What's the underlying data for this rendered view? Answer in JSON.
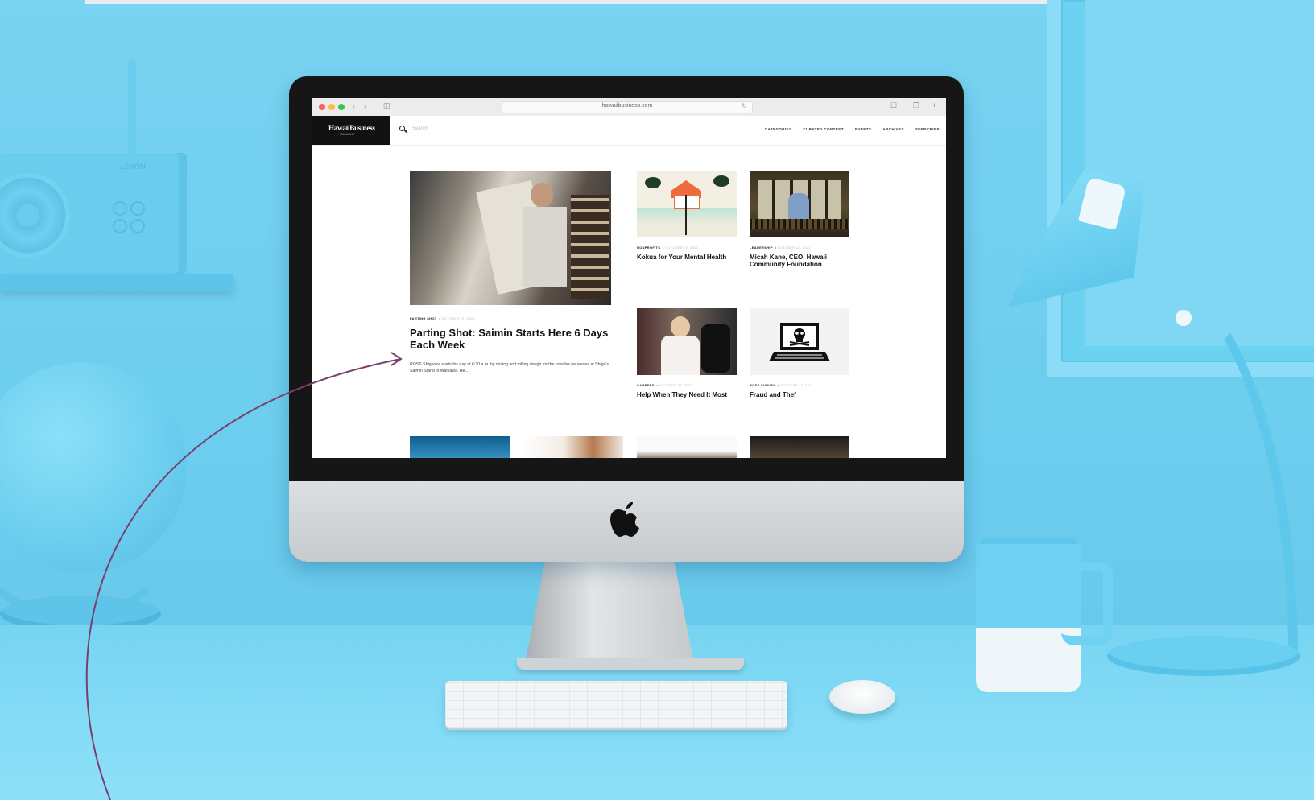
{
  "browser": {
    "url": "hawaiibusiness.com"
  },
  "site": {
    "logo": "HawaiiBusiness",
    "logo_sub": "MAGAZINE",
    "search_placeholder": "Search",
    "nav": [
      "CATEGORIES",
      "CURATED CONTENT",
      "EVENTS",
      "ARCHIVES",
      "SUBSCRIBE"
    ]
  },
  "featured": {
    "kicker": "PARTING SHOT",
    "date": "OCTOBER 22, 2021",
    "title": "Parting Shot: Saimin Starts Here 6 Days Each Week",
    "excerpt": "ROSS Shigeoka starts his day at 6:30 a.m. by mixing and rolling dough for the noodles he serves at Shige's Saimin Stand in Wahiawa. He..."
  },
  "cards": [
    {
      "kicker": "NONPROFITS",
      "date": "OCTOBER 22, 2021",
      "title": "Kokua for Your Mental Health",
      "image": "illustration-house-beach"
    },
    {
      "kicker": "LEADERSHIP",
      "date": "OCTOBER 22, 2021",
      "title": "Micah Kane, CEO, Hawaii Community Foundation",
      "image": "man-on-balcony"
    },
    {
      "kicker": "CAREERS",
      "date": "OCTOBER 22, 2021",
      "title": "Help When They Need It Most",
      "image": "woman-in-office-chair"
    },
    {
      "kicker": "BOSS SURVEY",
      "date": "OCTOBER 22, 2021",
      "title": "Fraud and Thef",
      "image": "laptop-skull-icon"
    }
  ],
  "scene": {
    "radio_brand": "LEXON"
  },
  "colors": {
    "background": "#6fd0ef",
    "arrow": "#7a3f6e"
  }
}
